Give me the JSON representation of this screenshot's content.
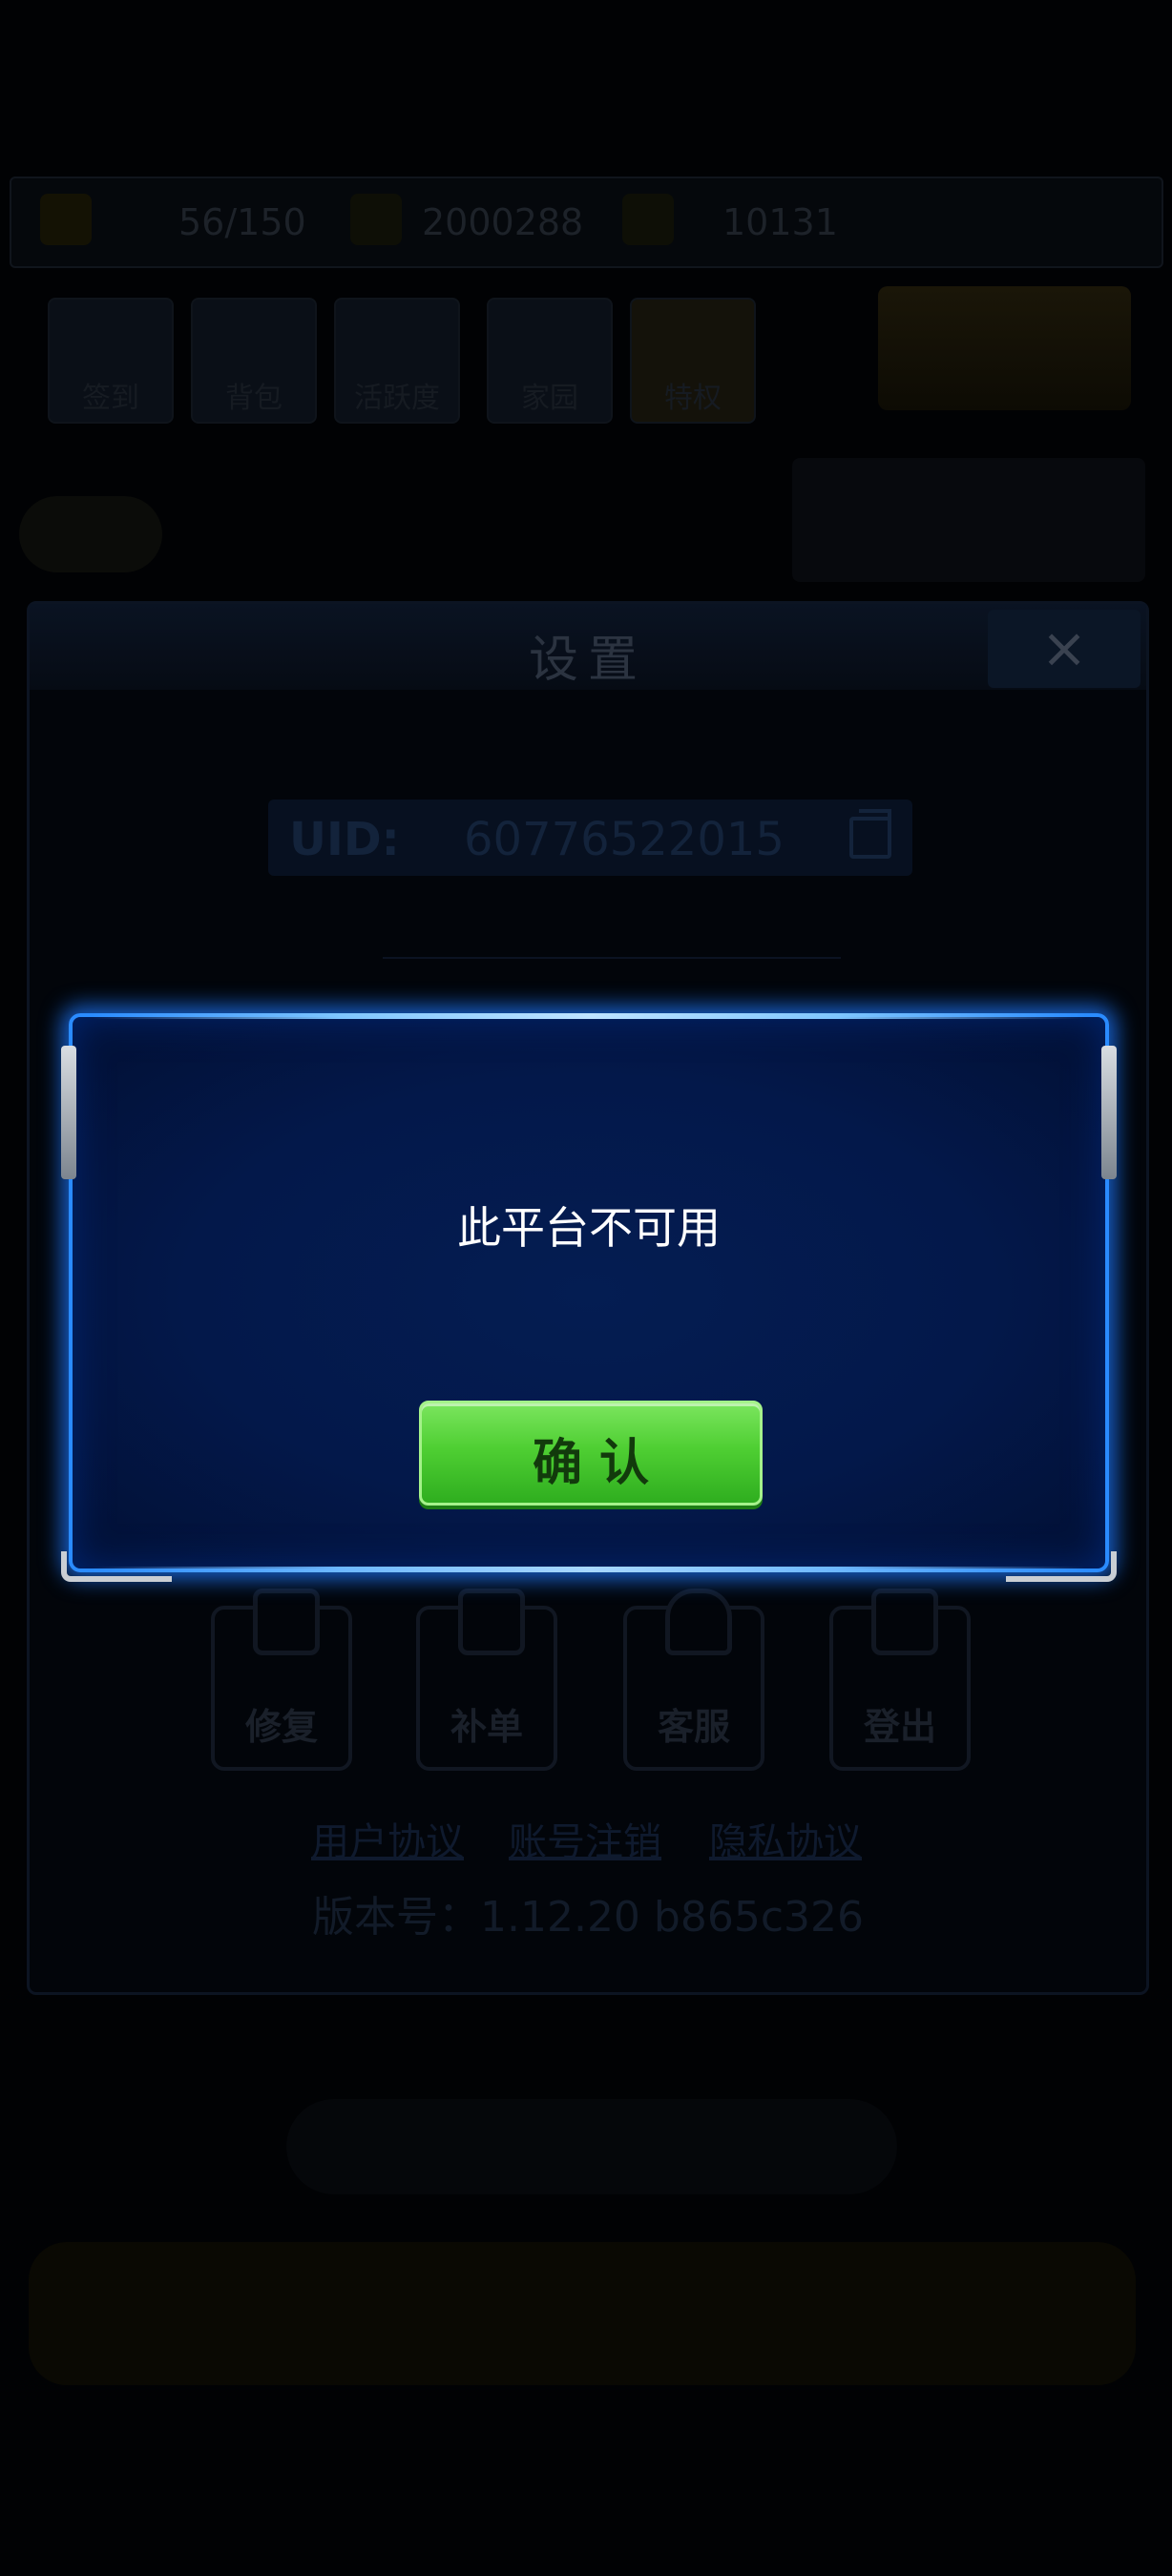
{
  "topbar": {
    "energy": "56/150",
    "coins": "2000288",
    "gems": "10131"
  },
  "feature_icons": [
    "签到",
    "背包",
    "活跃度",
    "家园",
    "特权"
  ],
  "settings": {
    "title": "设置",
    "close_icon": "×",
    "uid_label": "UID:",
    "uid_value": "60776522015",
    "tools": [
      {
        "label": "修复",
        "icon": "wrench-icon"
      },
      {
        "label": "补单",
        "icon": "order-icon"
      },
      {
        "label": "客服",
        "icon": "headset-icon"
      },
      {
        "label": "登出",
        "icon": "logout-icon"
      }
    ],
    "links": {
      "user_agreement": "用户协议",
      "account_cancel": "账号注销",
      "privacy": "隐私协议"
    },
    "version": "版本号：1.12.20   b865c326"
  },
  "modal": {
    "message": "此平台不可用",
    "confirm_label": "确认"
  },
  "colors": {
    "modal_border": "#2a8bff",
    "modal_bg": "#03184a",
    "button_green": "#4fcf33"
  }
}
